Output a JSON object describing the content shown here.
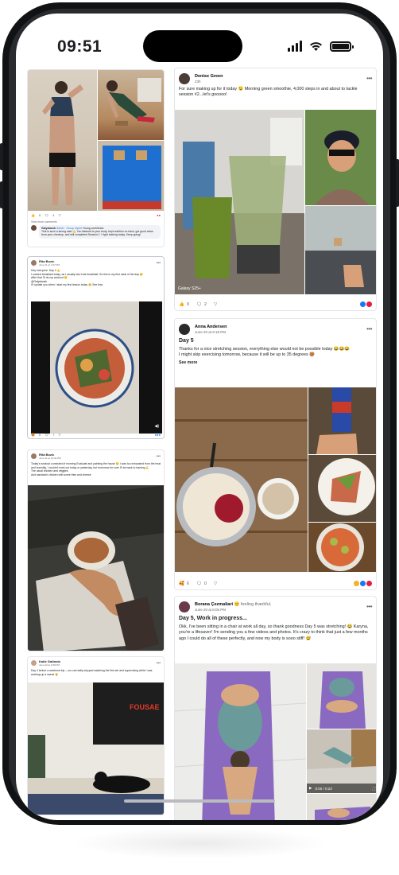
{
  "status_bar": {
    "time": "09:51"
  },
  "left_column": [
    {
      "id": "post-a",
      "reactions": "6",
      "comments": "4",
      "view_more": "View more comments",
      "comment": {
        "author": "Galyslaush",
        "badge": "Admin · Group expert",
        "flair": "Young contributor",
        "text": "This is such a strong start 💪 You listened to your body, kept nutrition on track, got good news from your checkup, and still completed Session 1 + light training today. Keep going!"
      }
    },
    {
      "id": "post-b",
      "author": "Rita Bozic",
      "meta": "June 21 at 2:47 PM",
      "text": "Hey everyone. Day 4 💪\nI cooked breakfast today, as I usually don't eat breakfast. So this is my first meal of the day 😊\nAfter that I'll do my workout 🙂\n@Galyslaush\nI'll update you when I start my first lesson today 😊 See less",
      "reactions": "6",
      "comments": "7"
    },
    {
      "id": "post-c",
      "author": "Rita Bozic",
      "meta": "June 21 at 10:04 PM",
      "text": "Today's workout consisted of morning Evaluate and painting the house 🙂 I was too exhausted from the heat and humidity. I couldn't work out today or yesterday, but tomorrow for sure I'll be back to training 💪\nThe usual chicken and veggies\nAnd sandwich chicken with some fries and cheese"
    },
    {
      "id": "post-d",
      "author": "Katie Gallardo",
      "meta": "June 20 at 9:38 PM",
      "text": "Day 4 before a weekend trip – our cat really enjoyed watching the first set and supervising while I was working up a sweat 😸",
      "brand": "FOUSAE"
    }
  ],
  "right_column": [
    {
      "id": "post-denise",
      "author": "Denise Green",
      "meta": "23h",
      "text": "For sure making up for it today 😉 Morning green smoothie, 4,000 steps in and about to tackle session #2...let's gooooo!",
      "watermark": "Galaxy S25+",
      "reactions": "9",
      "comments": "2"
    },
    {
      "id": "post-anna",
      "author": "Anna Andersen",
      "meta": "June 20 at 9:18 PM",
      "title": "Day 5",
      "text": "Thanks for a nice stretching session, everything else would not be possible today 😂😂😂\nI might skip exercising tomorrow, because it will be up to 35 degrees 🥵",
      "see_more": "See more",
      "reactions": "6",
      "comments": "0"
    },
    {
      "id": "post-borana",
      "author": "Borana Çezmaliari",
      "feeling": "feeling thankful.",
      "meta": "June 20 at 8:06 PM",
      "title": "Day 5, Work in progress...",
      "text": "Okk, I've been sitting in a chair at work all day, so thank goodness Day 5 was stretching! 😂 Karyna, you're a lifesaver! I'm sending you a few videos and photos. It's crazy to think that just a few months ago I could do all of these perfectly, and now my body is sooo stiff! 😅",
      "video_time": "0:00 / 0:23"
    }
  ]
}
